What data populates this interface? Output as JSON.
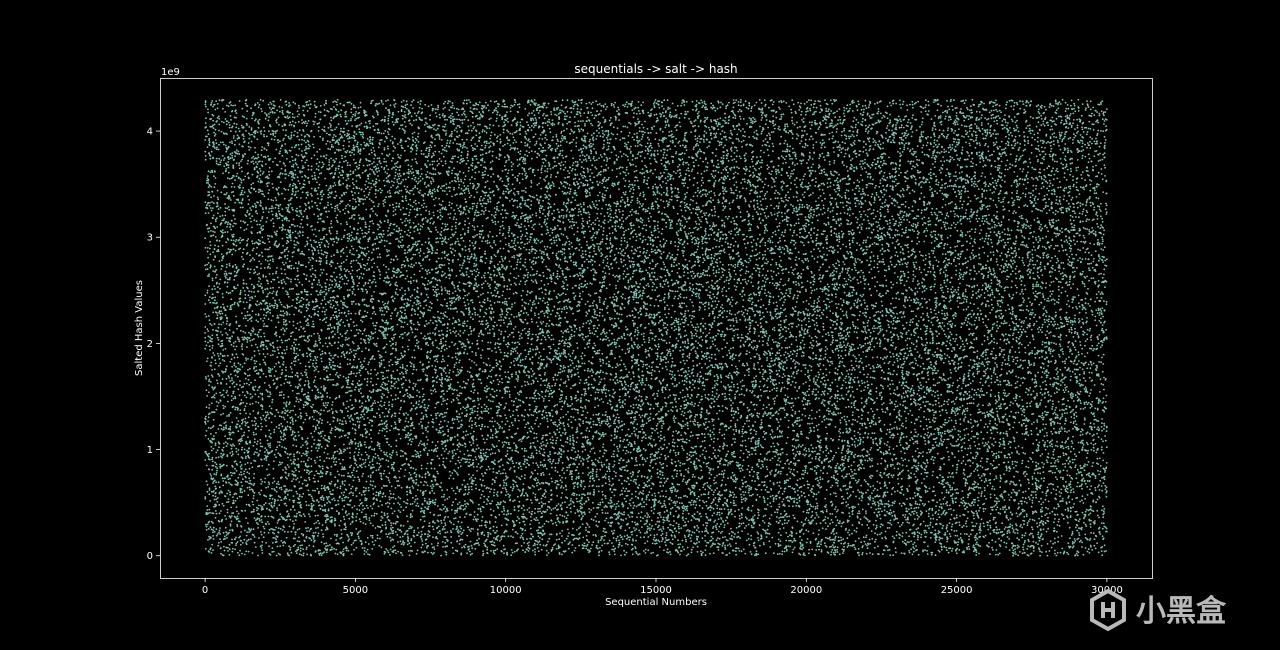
{
  "chart_data": {
    "type": "scatter",
    "title": "sequentials -> salt -> hash",
    "xlabel": "Sequential Numbers",
    "ylabel": "Salted Hash Values",
    "y_offset_text": "1e9",
    "xlim": [
      -1500,
      31500
    ],
    "ylim": [
      -210000000.0,
      4500000000.0
    ],
    "x_ticks": [
      0,
      5000,
      10000,
      15000,
      20000,
      25000,
      30000
    ],
    "x_tick_labels": [
      "0",
      "5000",
      "10000",
      "15000",
      "20000",
      "25000",
      "30000"
    ],
    "y_ticks": [
      0,
      1000000000,
      2000000000,
      3000000000,
      4000000000
    ],
    "y_tick_labels": [
      "0",
      "1",
      "2",
      "3",
      "4"
    ],
    "grid": false,
    "series": [
      {
        "n_points": 30000,
        "x_range": [
          0,
          30000
        ],
        "y_range": [
          0,
          4294967295
        ],
        "distribution": "uniform",
        "marker_color": "#7ec8b4"
      }
    ],
    "background": "#000000",
    "axis_color": "#ffffff"
  },
  "watermark": {
    "text": "小黑盒"
  }
}
